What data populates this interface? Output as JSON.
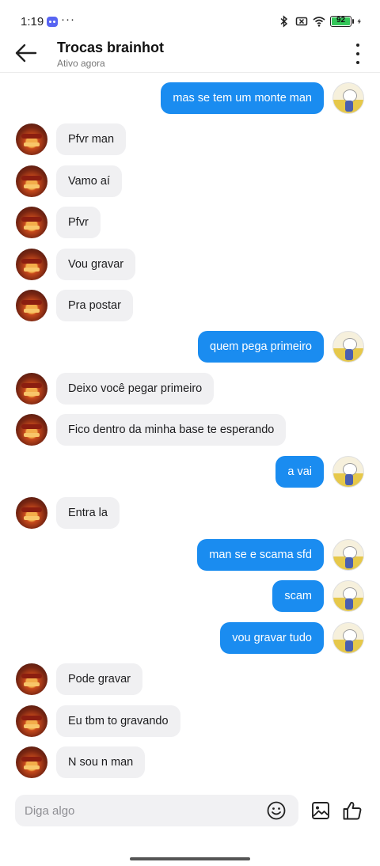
{
  "status_bar": {
    "time": "1:19",
    "more": "···",
    "battery": "92"
  },
  "header": {
    "title": "Trocas brainhot",
    "subtitle": "Ativo agora"
  },
  "messages": [
    {
      "side": "out",
      "text": "mas se tem um monte man"
    },
    {
      "side": "in",
      "text": "Pfvr man"
    },
    {
      "side": "in",
      "text": "Vamo aí"
    },
    {
      "side": "in",
      "text": "Pfvr"
    },
    {
      "side": "in",
      "text": "Vou gravar"
    },
    {
      "side": "in",
      "text": "Pra postar"
    },
    {
      "side": "out",
      "text": "quem pega primeiro"
    },
    {
      "side": "in",
      "text": "Deixo você pegar primeiro"
    },
    {
      "side": "in",
      "text": "Fico dentro da minha base te esperando"
    },
    {
      "side": "out",
      "text": "a vai"
    },
    {
      "side": "in",
      "text": "Entra la"
    },
    {
      "side": "out",
      "text": "man se e scama sfd"
    },
    {
      "side": "out",
      "text": "scam"
    },
    {
      "side": "out",
      "text": "vou gravar tudo"
    },
    {
      "side": "in",
      "text": "Pode gravar"
    },
    {
      "side": "in",
      "text": "Eu tbm to gravando"
    },
    {
      "side": "in",
      "text": "N sou n man"
    }
  ],
  "composer": {
    "placeholder": "Diga algo"
  },
  "colors": {
    "outgoing_bubble": "#1a8cf0",
    "incoming_bubble": "#f0f0f2"
  }
}
